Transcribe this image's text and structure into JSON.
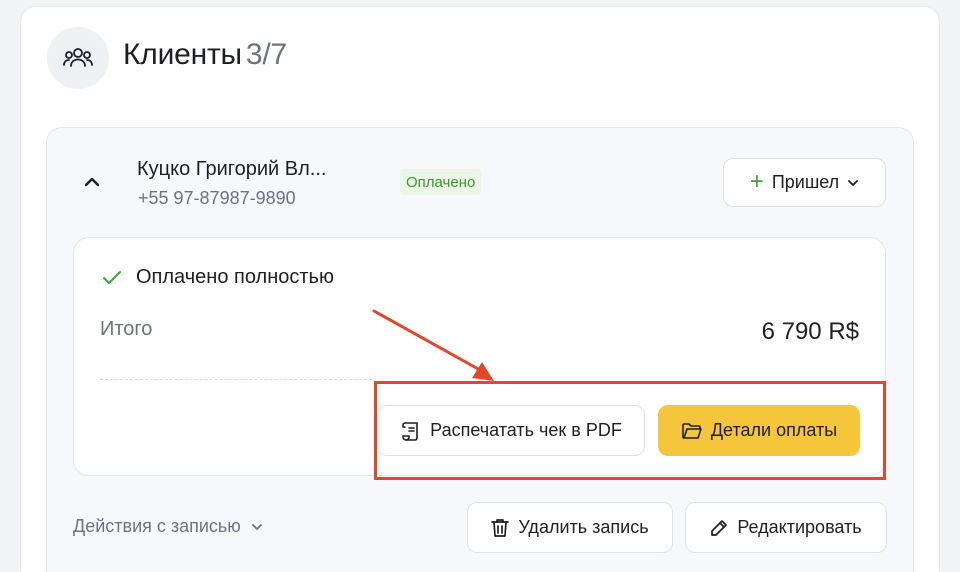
{
  "header": {
    "title": "Клиенты",
    "count": "3/7",
    "icon": "users-icon"
  },
  "client": {
    "name": "Куцко Григорий Вл...",
    "phone": "+55 97-87987-9890",
    "status": "Оплачено",
    "attended_label": "Пришел"
  },
  "payment": {
    "paid_label": "Оплачено полностью",
    "total_label": "Итого",
    "total_value": "6 790 R$",
    "print_label": "Распечатать чек в PDF",
    "details_label": "Детали оплаты"
  },
  "footer": {
    "actions_label": "Действия с записью",
    "delete_label": "Удалить запись",
    "edit_label": "Редактировать"
  },
  "colors": {
    "accent_yellow": "#f5c53b",
    "status_green": "#3b9a2e",
    "status_bg": "#eaf6e6",
    "highlight_red": "#e0472b"
  }
}
